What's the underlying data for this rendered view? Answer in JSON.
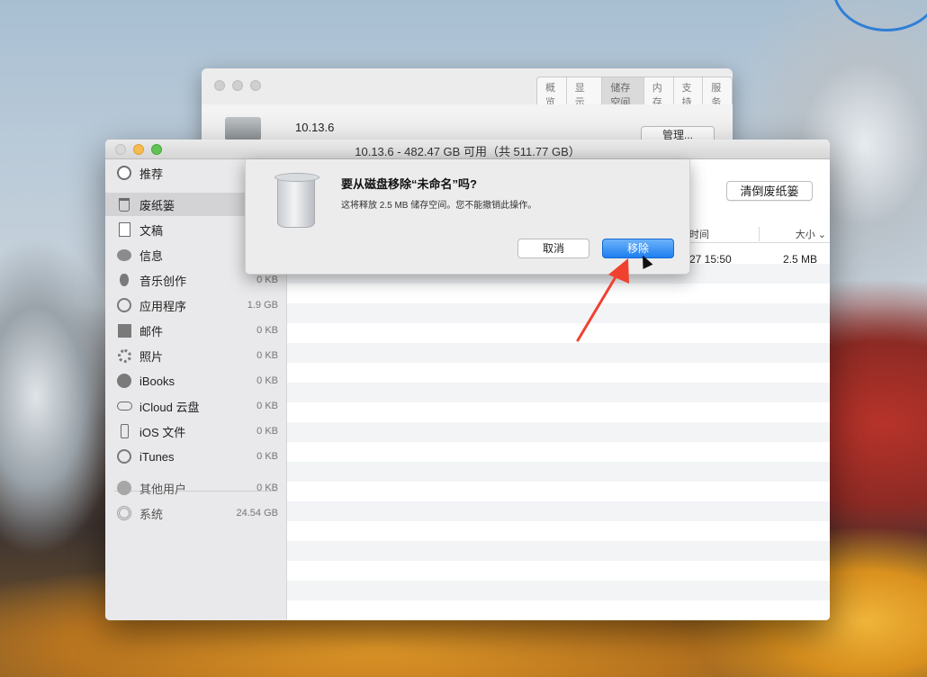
{
  "back_window": {
    "tabs": [
      {
        "label": "概览"
      },
      {
        "label": "显示器"
      },
      {
        "label": "储存空间",
        "active": true
      },
      {
        "label": "内存"
      },
      {
        "label": "支持"
      },
      {
        "label": "服务"
      }
    ],
    "version": "10.13.6",
    "manage_label": "管理..."
  },
  "main_window": {
    "title": "10.13.6 - 482.47 GB 可用（共 511.77 GB）",
    "sidebar": {
      "items": [
        {
          "label": "推荐",
          "size": "",
          "icon": "lightbulb-icon"
        },
        {
          "label": "废纸篓",
          "size": "",
          "icon": "trash-icon",
          "selected": true
        },
        {
          "label": "文稿",
          "size": "",
          "icon": "document-icon"
        },
        {
          "label": "信息",
          "size": "",
          "icon": "messages-icon"
        },
        {
          "label": "音乐创作",
          "size": "0 KB",
          "icon": "guitar-icon"
        },
        {
          "label": "应用程序",
          "size": "1.9 GB",
          "icon": "app-store-icon"
        },
        {
          "label": "邮件",
          "size": "0 KB",
          "icon": "mail-icon"
        },
        {
          "label": "照片",
          "size": "0 KB",
          "icon": "photos-icon"
        },
        {
          "label": "iBooks",
          "size": "0 KB",
          "icon": "ibooks-icon"
        },
        {
          "label": "iCloud 云盘",
          "size": "0 KB",
          "icon": "cloud-icon"
        },
        {
          "label": "iOS 文件",
          "size": "0 KB",
          "icon": "iphone-icon"
        },
        {
          "label": "iTunes",
          "size": "0 KB",
          "icon": "itunes-icon"
        }
      ],
      "other_items": [
        {
          "label": "其他用户",
          "size": "0 KB",
          "icon": "users-icon"
        },
        {
          "label": "系统",
          "size": "24.54 GB",
          "icon": "gear-icon"
        }
      ]
    },
    "empty_trash_label": "清倒废纸篓",
    "table": {
      "col_time": "时间",
      "col_size": "大小 ⌄",
      "rows": [
        {
          "time": "27 15:50",
          "size": "2.5 MB"
        }
      ]
    }
  },
  "dialog": {
    "title": "要从磁盘移除“未命名”吗?",
    "message": "这将释放 2.5 MB 储存空间。您不能撤销此操作。",
    "cancel_label": "取消",
    "remove_label": "移除"
  }
}
